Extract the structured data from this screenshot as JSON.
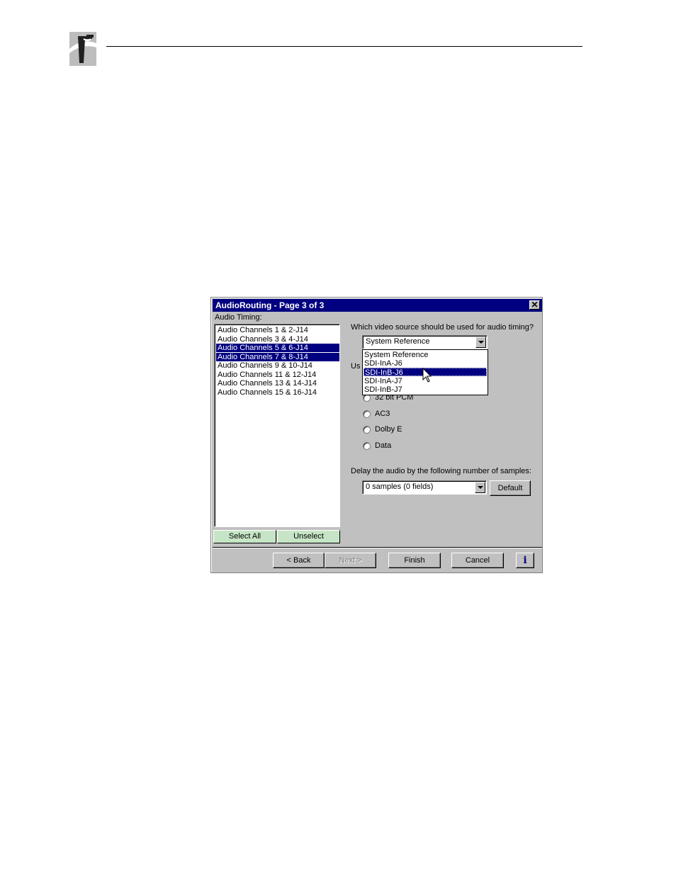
{
  "dialog": {
    "title": "AudioRouting - Page 3 of 3",
    "close_glyph": "✕",
    "audio_timing_label": "Audio Timing:",
    "channels": [
      {
        "label": "Audio Channels 1 & 2-J14",
        "selected": false
      },
      {
        "label": "Audio Channels 3 & 4-J14",
        "selected": false
      },
      {
        "label": "Audio Channels 5 & 6-J14",
        "selected": true
      },
      {
        "label": "Audio Channels 7 & 8-J14",
        "selected": true
      },
      {
        "label": "Audio Channels 9 & 10-J14",
        "selected": false
      },
      {
        "label": "Audio Channels 11 & 12-J14",
        "selected": false
      },
      {
        "label": "Audio Channels 13 & 14-J14",
        "selected": false
      },
      {
        "label": "Audio Channels 15 & 16-J14",
        "selected": false
      }
    ],
    "select_all_label": "Select All",
    "unselect_label": "Unselect",
    "video_source_question": "Which video source should be used for audio timing?",
    "video_source_value": "System Reference",
    "video_source_options": [
      "System Reference",
      "SDI-InA-J6",
      "SDI-InB-J6",
      "SDI-InA-J7",
      "SDI-InB-J7"
    ],
    "video_source_highlighted": "SDI-InB-J6",
    "partial_label": "Us",
    "radio_options": [
      "32 bit PCM",
      "AC3",
      "Dolby E",
      "Data"
    ],
    "delay_label": "Delay the audio by the following number of samples:",
    "delay_value": "0 samples (0 fields)",
    "default_label": "Default",
    "back_label": "< Back",
    "next_label": "Next >",
    "finish_label": "Finish",
    "cancel_label": "Cancel",
    "info_label": "i"
  },
  "colors": {
    "titlebar": "#000080",
    "face": "#c0c0c0",
    "selection": "#000080",
    "green_button": "#c6e5c6"
  }
}
